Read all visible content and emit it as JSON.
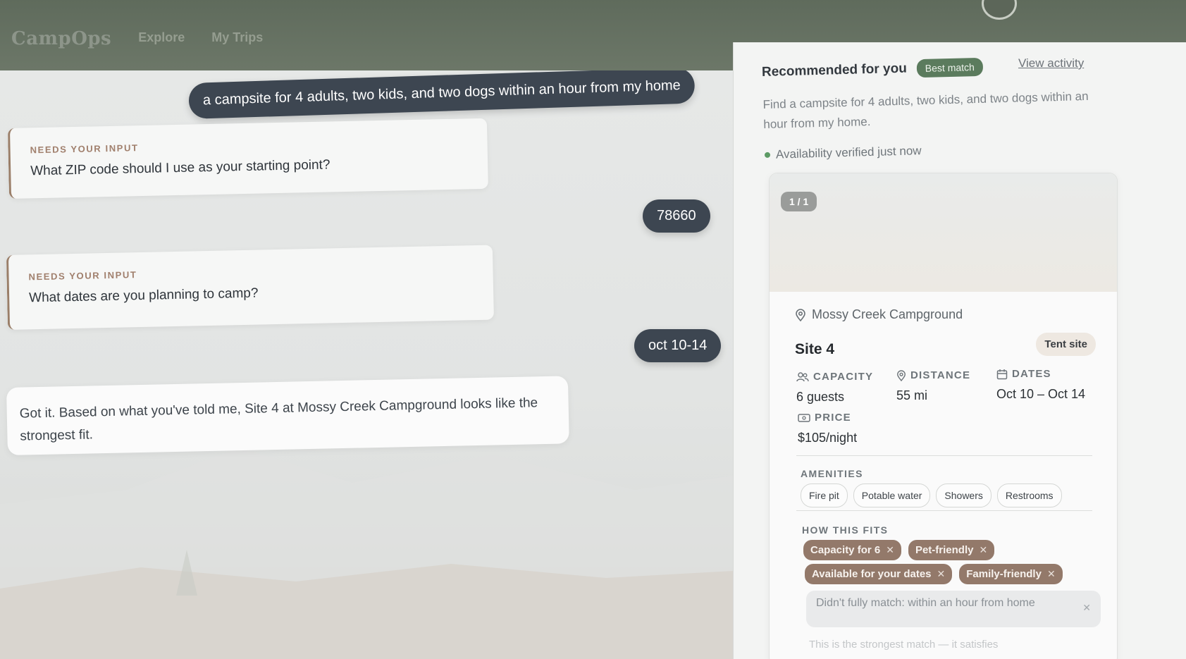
{
  "nav": {
    "brand": "CampOps",
    "links": [
      "Explore",
      "My Trips"
    ]
  },
  "chat": {
    "user_messages": [
      "a campsite for 4 adults, two kids, and two dogs within an hour from my home",
      "78660",
      "oct 10-14"
    ],
    "prompts": [
      {
        "tag": "NEEDS YOUR INPUT",
        "question": "What ZIP code should I use as your starting point?"
      },
      {
        "tag": "NEEDS YOUR INPUT",
        "question": "What dates are you planning to camp?"
      }
    ],
    "assistant_reply": "Got it. Based on what you've told me, Site 4 at Mossy Creek Campground looks like the strongest fit."
  },
  "panel": {
    "title": "Recommended for you",
    "badge": "Best match",
    "view_activity": "View activity",
    "description": "Find a campsite for 4 adults, two kids, and two dogs within an hour from my home.",
    "verified": "Availability verified just now",
    "card": {
      "counter": "1 / 1",
      "campground": "Mossy Creek Campground",
      "site": "Site 4",
      "site_type": "Tent site",
      "stats": {
        "capacity_label": "CAPACITY",
        "capacity_value": "6 guests",
        "distance_label": "DISTANCE",
        "distance_value": "55 mi",
        "dates_label": "DATES",
        "dates_value": "Oct 10 – Oct 14",
        "price_label": "PRICE",
        "price_value": "$105/night"
      },
      "amenities_label": "AMENITIES",
      "amenities": [
        "Fire pit",
        "Potable water",
        "Showers",
        "Restrooms"
      ],
      "fits_label": "HOW THIS FITS",
      "fits": [
        "Capacity for 6",
        "Pet-friendly",
        "Available for your dates",
        "Family-friendly"
      ],
      "unmatched": "Didn't fully match: within an hour from home",
      "footnote": "This is the strongest match — it satisfies"
    }
  },
  "colors": {
    "nav_bg": "#66715f",
    "user_bubble": "#3d4651",
    "accent_tag": "#a07f6c",
    "fit_chip": "#93796a",
    "best_match": "#5b7b5d"
  },
  "icons": [
    "location-pin-icon",
    "users-icon",
    "distance-pin-icon",
    "calendar-icon",
    "ticket-icon",
    "close-icon"
  ]
}
